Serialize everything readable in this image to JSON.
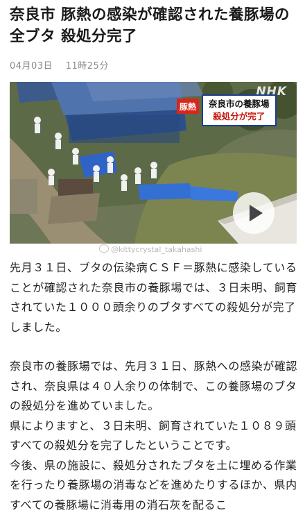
{
  "article": {
    "title": "奈良市 豚熱の感染が確認された養豚場の全ブタ 殺処分完了",
    "date": "04月03日",
    "time": "11時25分",
    "video": {
      "broadcaster_logo": "NHK",
      "caption_tag": "豚熱",
      "caption_line1": "奈良市の養豚場",
      "caption_line2": "殺処分が完了",
      "play_button": "play-icon"
    },
    "watermark": "@kittycrystal_takahashi",
    "paragraphs": [
      "先月３１日、ブタの伝染病ＣＳＦ＝豚熱に感染していることが確認された奈良市の養豚場では、３日未明、飼育されていた１０００頭余りのブタすべての殺処分が完了しました。",
      "奈良市の養豚場では、先月３１日、豚熱への感染が確認され、奈良県は４０人余りの体制で、この養豚場のブタの殺処分を進めていました。",
      "県によりますと、３日未明、飼育されていた１０８９頭すべての殺処分を完了したということです。",
      "今後、県の施設に、殺処分されたブタを土に埋める作業を行ったり養豚場の消毒などを進めたりするほか、県内すべての養豚場に消毒用の消石灰を配るこ"
    ]
  },
  "colors": {
    "caption_tag": "#d9261c",
    "caption_border": "#1c3f94",
    "caption_highlight": "#c6140c",
    "meta_text": "#8a8a8a"
  }
}
